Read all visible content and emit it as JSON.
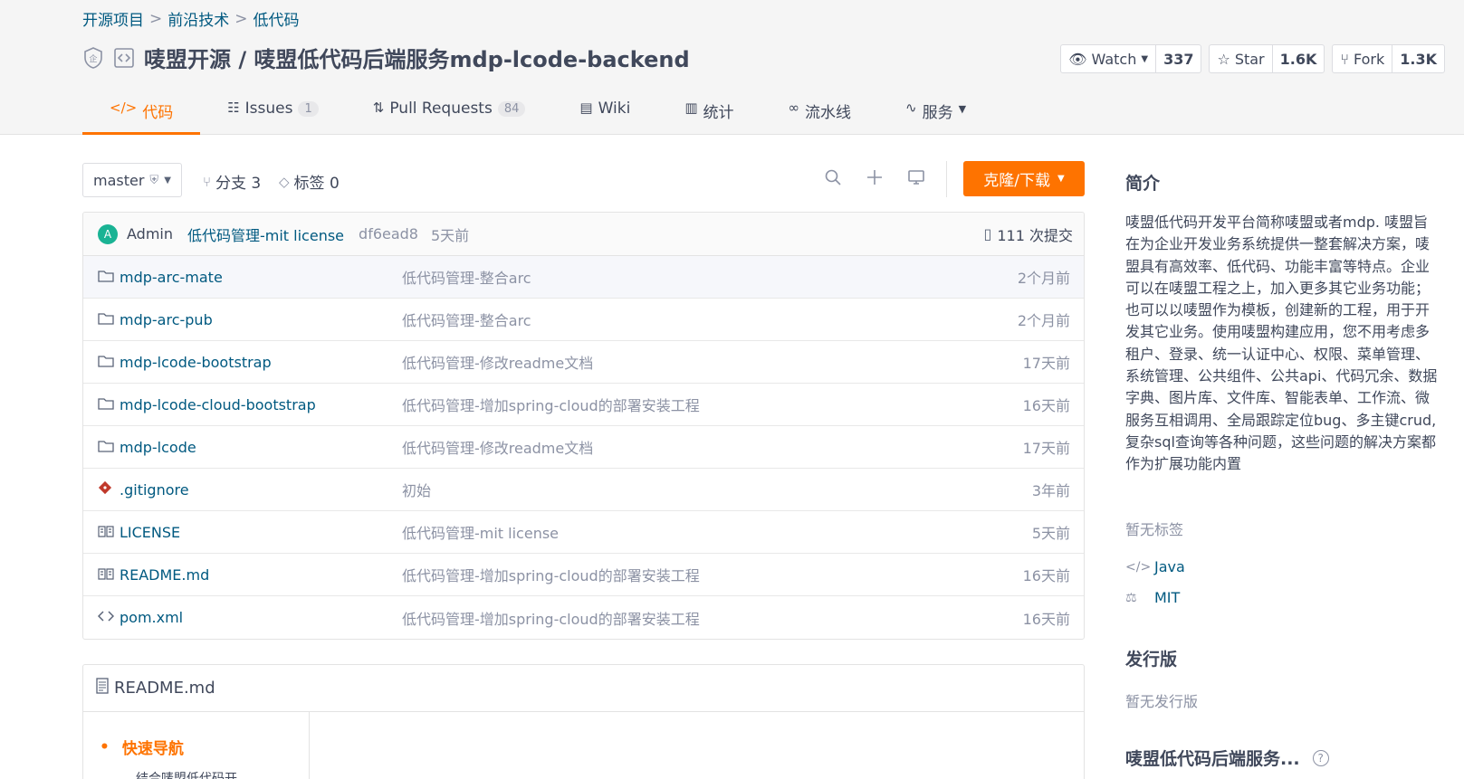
{
  "breadcrumb": [
    "开源项目",
    "前沿技术",
    "低代码"
  ],
  "breadcrumb_sep": ">",
  "repo": {
    "title": "唛盟开源 / 唛盟低代码后端服务mdp-lcode-backend"
  },
  "actions": {
    "watch": {
      "label": "Watch",
      "count": "337"
    },
    "star": {
      "label": "Star",
      "count": "1.6K"
    },
    "fork": {
      "label": "Fork",
      "count": "1.3K"
    }
  },
  "tabs": [
    {
      "label": "代码",
      "icon": "code-icon"
    },
    {
      "label": "Issues",
      "badge": "1",
      "icon": "issues-icon"
    },
    {
      "label": "Pull Requests",
      "badge": "84",
      "icon": "pull-request-icon"
    },
    {
      "label": "Wiki",
      "icon": "wiki-icon"
    },
    {
      "label": "统计",
      "icon": "stats-icon"
    },
    {
      "label": "流水线",
      "icon": "pipeline-icon"
    },
    {
      "label": "服务",
      "icon": "service-icon"
    }
  ],
  "toolbar": {
    "branch": "master",
    "branches": "分支 3",
    "tags": "标签 0",
    "clone_label": "克隆/下载"
  },
  "commit": {
    "avatar_letter": "A",
    "author": "Admin",
    "message": "低代码管理-mit license",
    "sha": "df6ead8",
    "time": "5天前",
    "count": "111 次提交"
  },
  "files": [
    {
      "icon": "folder-icon",
      "name": "mdp-arc-mate",
      "message": "低代码管理-整合arc",
      "time": "2个月前"
    },
    {
      "icon": "folder-icon",
      "name": "mdp-arc-pub",
      "message": "低代码管理-整合arc",
      "time": "2个月前"
    },
    {
      "icon": "folder-icon",
      "name": "mdp-lcode-bootstrap",
      "message": "低代码管理-修改readme文档",
      "time": "17天前"
    },
    {
      "icon": "folder-icon",
      "name": "mdp-lcode-cloud-bootstrap",
      "message": "低代码管理-增加spring-cloud的部署安装工程",
      "time": "16天前"
    },
    {
      "icon": "folder-icon",
      "name": "mdp-lcode",
      "message": "低代码管理-修改readme文档",
      "time": "17天前"
    },
    {
      "icon": "git-icon",
      "name": ".gitignore",
      "message": "初始",
      "time": "3年前"
    },
    {
      "icon": "book-icon",
      "name": "LICENSE",
      "message": "低代码管理-mit license",
      "time": "5天前"
    },
    {
      "icon": "book-icon",
      "name": "README.md",
      "message": "低代码管理-增加spring-cloud的部署安装工程",
      "time": "16天前"
    },
    {
      "icon": "code-file-icon",
      "name": "pom.xml",
      "message": "低代码管理-增加spring-cloud的部署安装工程",
      "time": "16天前"
    }
  ],
  "readme": {
    "title": "README.md",
    "nav_first": "快速导航",
    "nav_second": "结合唛盟低代码开"
  },
  "sidebar": {
    "intro_title": "简介",
    "intro_text": "唛盟低代码开发平台简称唛盟或者mdp. 唛盟旨在为企业开发业务系统提供一整套解决方案，唛盟具有高效率、低代码、功能丰富等特点。企业可以在唛盟工程之上，加入更多其它业务功能；也可以以唛盟作为模板，创建新的工程，用于开发其它业务。使用唛盟构建应用，您不用考虑多租户、登录、统一认证中心、权限、菜单管理、系统管理、公共组件、公共api、代码冗余、数据字典、图片库、文件库、智能表单、工作流、微服务互相调用、全局跟踪定位bug、多主键crud,复杂sql查询等各种问题，这些问题的解决方案都作为扩展功能内置",
    "no_tags": "暂无标签",
    "language": "Java",
    "license": "MIT",
    "release_title": "发行版",
    "no_release": "暂无发行版",
    "project_title": "唛盟低代码后端服务..."
  },
  "colors": {
    "accent": "#fe7300",
    "link": "#005980",
    "muted": "#8c92a4",
    "avatar": "#1ab394"
  }
}
